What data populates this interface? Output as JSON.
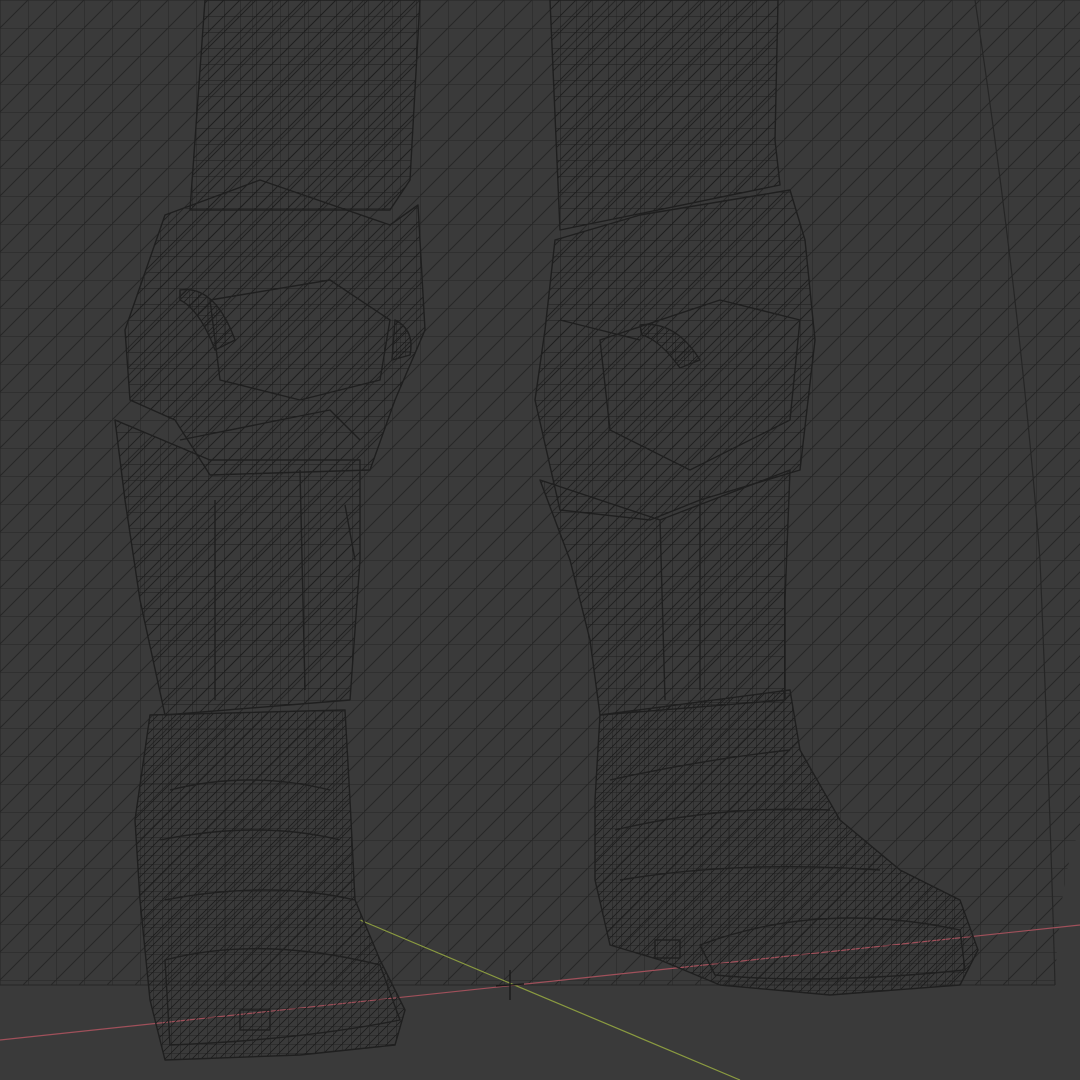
{
  "viewport": {
    "mode": "wireframe",
    "colors": {
      "background": "#3a3a3a",
      "wire": "#1f1f1f",
      "wire_light": "#2b2b2b",
      "axis_x": "#a0505a",
      "axis_y": "#8a9a40",
      "cursor": "#1a1a1a"
    }
  }
}
